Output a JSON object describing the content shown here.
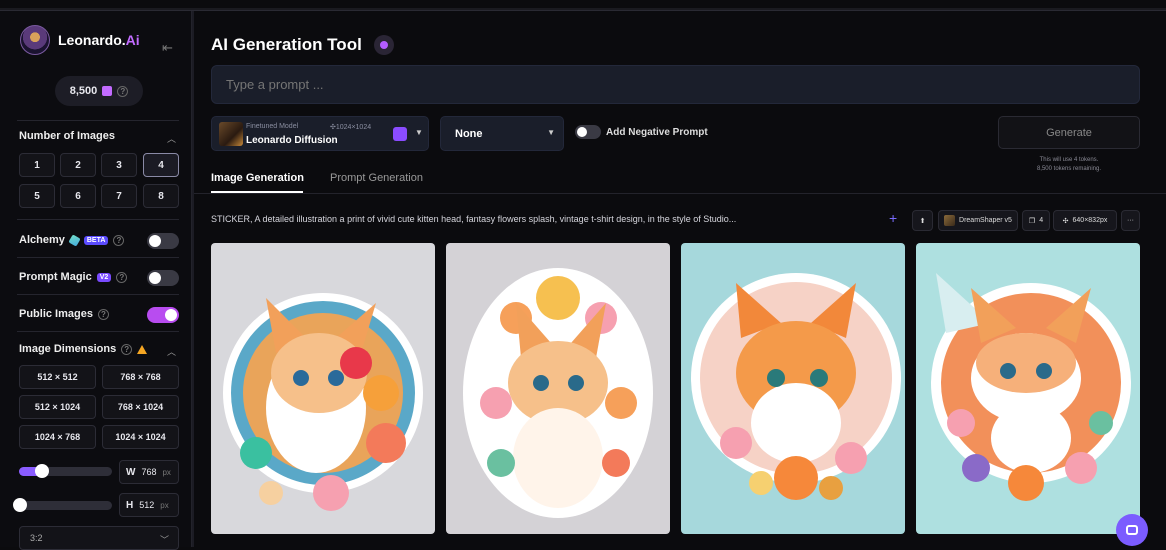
{
  "brand": {
    "name_prefix": "Leonardo.",
    "name_suffix": "Ai"
  },
  "tokens": {
    "count": "8,500"
  },
  "sidebar": {
    "number_of_images": {
      "label": "Number of Images",
      "options": [
        "1",
        "2",
        "3",
        "4",
        "5",
        "6",
        "7",
        "8"
      ],
      "selected": "4"
    },
    "alchemy": {
      "label": "Alchemy",
      "badge": "BETA",
      "enabled": false
    },
    "prompt_magic": {
      "label": "Prompt Magic",
      "badge": "V2",
      "enabled": false
    },
    "public_images": {
      "label": "Public Images",
      "enabled": true
    },
    "image_dimensions": {
      "label": "Image Dimensions",
      "options": [
        "512 × 512",
        "768 × 768",
        "512 × 1024",
        "768 × 1024",
        "1024 × 768",
        "1024 × 1024"
      ]
    },
    "width": {
      "key": "W",
      "value": "768",
      "unit": "px",
      "slider_fraction": 0.25
    },
    "height": {
      "key": "H",
      "value": "512",
      "unit": "px",
      "slider_fraction": 0.0
    },
    "aspect_ratio": {
      "value": "3:2"
    }
  },
  "main": {
    "title": "AI Generation Tool",
    "prompt_placeholder": "Type a prompt ...",
    "model": {
      "type": "Finetuned Model",
      "resolution": "1024×1024",
      "name": "Leonardo Diffusion"
    },
    "style": {
      "value": "None"
    },
    "negative_prompt": {
      "label": "Add Negative Prompt",
      "enabled": false
    },
    "generate": {
      "label": "Generate",
      "note_line1": "This will use 4 tokens.",
      "note_line2": "8,500 tokens remaining."
    },
    "tabs": [
      {
        "label": "Image Generation",
        "active": true
      },
      {
        "label": "Prompt Generation",
        "active": false
      }
    ],
    "generation": {
      "prompt": "STICKER, A detailed illustration a print of vivid cute kitten head, fantasy flowers splash, vintage t-shirt design, in the style of Studio...",
      "model_chip": "DreamShaper v5",
      "count_chip": "4",
      "size_chip": "640×832px",
      "more": "···"
    }
  },
  "colors": {
    "accent": "#b84cf0",
    "brand_purple": "#c26bff",
    "background": "#0b0b0e"
  }
}
